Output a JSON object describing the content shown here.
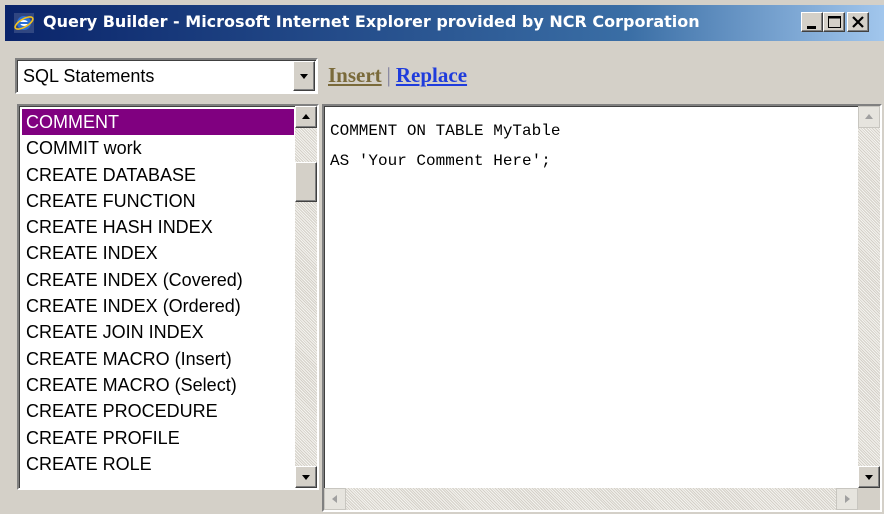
{
  "window": {
    "title": "Query Builder - Microsoft Internet Explorer provided by NCR Corporation",
    "icon": "internet-explorer-icon",
    "controls": [
      "minimize-icon",
      "maximize-icon",
      "close-icon"
    ]
  },
  "toolbar": {
    "statement_select": {
      "value": "SQL Statements"
    },
    "insert_label": "Insert",
    "separator": "|",
    "replace_label": "Replace"
  },
  "statement_list": {
    "selected_index": 0,
    "items": [
      "COMMENT",
      "COMMIT work",
      "CREATE DATABASE",
      "CREATE FUNCTION",
      "CREATE HASH INDEX",
      "CREATE INDEX",
      "CREATE INDEX (Covered)",
      "CREATE INDEX (Ordered)",
      "CREATE JOIN INDEX",
      "CREATE MACRO (Insert)",
      "CREATE MACRO (Select)",
      "CREATE PROCEDURE",
      "CREATE PROFILE",
      "CREATE ROLE"
    ]
  },
  "editor": {
    "lines": [
      "COMMENT ON TABLE MyTable",
      "AS 'Your Comment Here';"
    ]
  },
  "colors": {
    "selection": "#800080",
    "insert_link": "#7a6a3a",
    "replace_link": "#1f3cdc",
    "titlebar_start": "#0a246a"
  }
}
